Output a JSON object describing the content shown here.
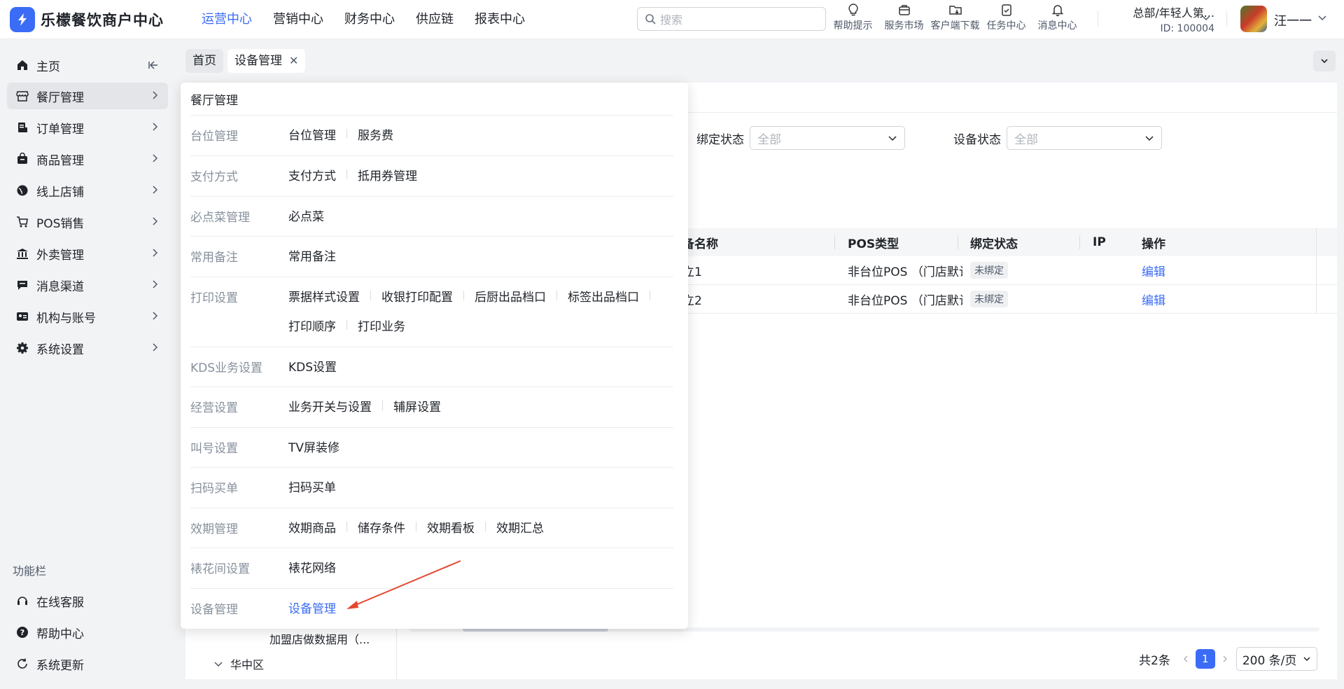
{
  "app": {
    "title": "乐檬餐饮商户中心",
    "brand_color": "#3b6cf6"
  },
  "topnav": [
    {
      "label": "运营中心",
      "active": true
    },
    {
      "label": "营销中心"
    },
    {
      "label": "财务中心"
    },
    {
      "label": "供应链"
    },
    {
      "label": "报表中心"
    }
  ],
  "search": {
    "placeholder": "搜索"
  },
  "tools": [
    {
      "label": "帮助提示",
      "icon": "bulb-icon"
    },
    {
      "label": "服务市场",
      "icon": "store-bag-icon"
    },
    {
      "label": "客户端下载",
      "icon": "download-folder-icon"
    },
    {
      "label": "任务中心",
      "icon": "clipboard-check-icon"
    },
    {
      "label": "消息中心",
      "icon": "bell-icon"
    }
  ],
  "org": {
    "name": "总部/年轻人第...",
    "id": "ID: 100004"
  },
  "user": {
    "name": "汪一一"
  },
  "sidebar": {
    "items": [
      {
        "label": "主页",
        "icon": "home-icon"
      },
      {
        "label": "餐厅管理",
        "icon": "storefront-icon",
        "active": true
      },
      {
        "label": "订单管理",
        "icon": "order-icon"
      },
      {
        "label": "商品管理",
        "icon": "bag-icon"
      },
      {
        "label": "线上店铺",
        "icon": "globe-icon"
      },
      {
        "label": "POS销售",
        "icon": "cart-icon"
      },
      {
        "label": "外卖管理",
        "icon": "bank-icon"
      },
      {
        "label": "消息渠道",
        "icon": "chat-icon"
      },
      {
        "label": "机构与账号",
        "icon": "id-card-icon"
      },
      {
        "label": "系统设置",
        "icon": "gear-icon"
      }
    ],
    "section_label": "功能栏",
    "bottom_items": [
      {
        "label": "在线客服",
        "icon": "headset-icon"
      },
      {
        "label": "帮助中心",
        "icon": "help-icon"
      },
      {
        "label": "系统更新",
        "icon": "refresh-icon"
      }
    ]
  },
  "tabs": [
    {
      "label": "首页"
    },
    {
      "label": "设备管理",
      "current": true
    }
  ],
  "filters": [
    {
      "label": "绑定状态",
      "value": "全部"
    },
    {
      "label": "设备状态",
      "value": "全部"
    }
  ],
  "table": {
    "headers": [
      "备名称",
      "POS类型",
      "绑定状态",
      "IP",
      "操作"
    ],
    "rows": [
      {
        "name": "立1",
        "pos_type": "非台位POS （门店默认",
        "bind_status": "未绑定",
        "ip": "",
        "action": "编辑"
      },
      {
        "name": "立2",
        "pos_type": "非台位POS （门店默认",
        "bind_status": "未绑定",
        "ip": "",
        "action": "编辑"
      }
    ]
  },
  "tree": {
    "item1": "加盟店做数据用（...",
    "item2": "华中区"
  },
  "pager": {
    "total": "共2条",
    "current_page": "1",
    "page_size": "200 条/页"
  },
  "flyout": {
    "title": "餐厅管理",
    "groups": [
      {
        "category": "台位管理",
        "links": [
          "台位管理",
          "服务费"
        ]
      },
      {
        "category": "支付方式",
        "links": [
          "支付方式",
          "抵用券管理"
        ]
      },
      {
        "category": "必点菜管理",
        "links": [
          "必点菜"
        ]
      },
      {
        "category": "常用备注",
        "links": [
          "常用备注"
        ]
      },
      {
        "category": "打印设置",
        "links": [
          "票据样式设置",
          "收银打印配置",
          "后厨出品档口",
          "标签出品档口",
          "打印顺序",
          "打印业务"
        ]
      },
      {
        "category": "KDS业务设置",
        "links": [
          "KDS设置"
        ]
      },
      {
        "category": "经营设置",
        "links": [
          "业务开关与设置",
          "辅屏设置"
        ]
      },
      {
        "category": "叫号设置",
        "links": [
          "TV屏装修"
        ]
      },
      {
        "category": "扫码买单",
        "links": [
          "扫码买单"
        ]
      },
      {
        "category": "效期管理",
        "links": [
          "效期商品",
          "储存条件",
          "效期看板",
          "效期汇总"
        ]
      },
      {
        "category": "裱花间设置",
        "links": [
          "裱花网络"
        ]
      },
      {
        "category": "设备管理",
        "links": [
          "设备管理"
        ],
        "active_link": 0
      }
    ]
  },
  "annotation": {
    "arrow_color": "#e4472e"
  }
}
